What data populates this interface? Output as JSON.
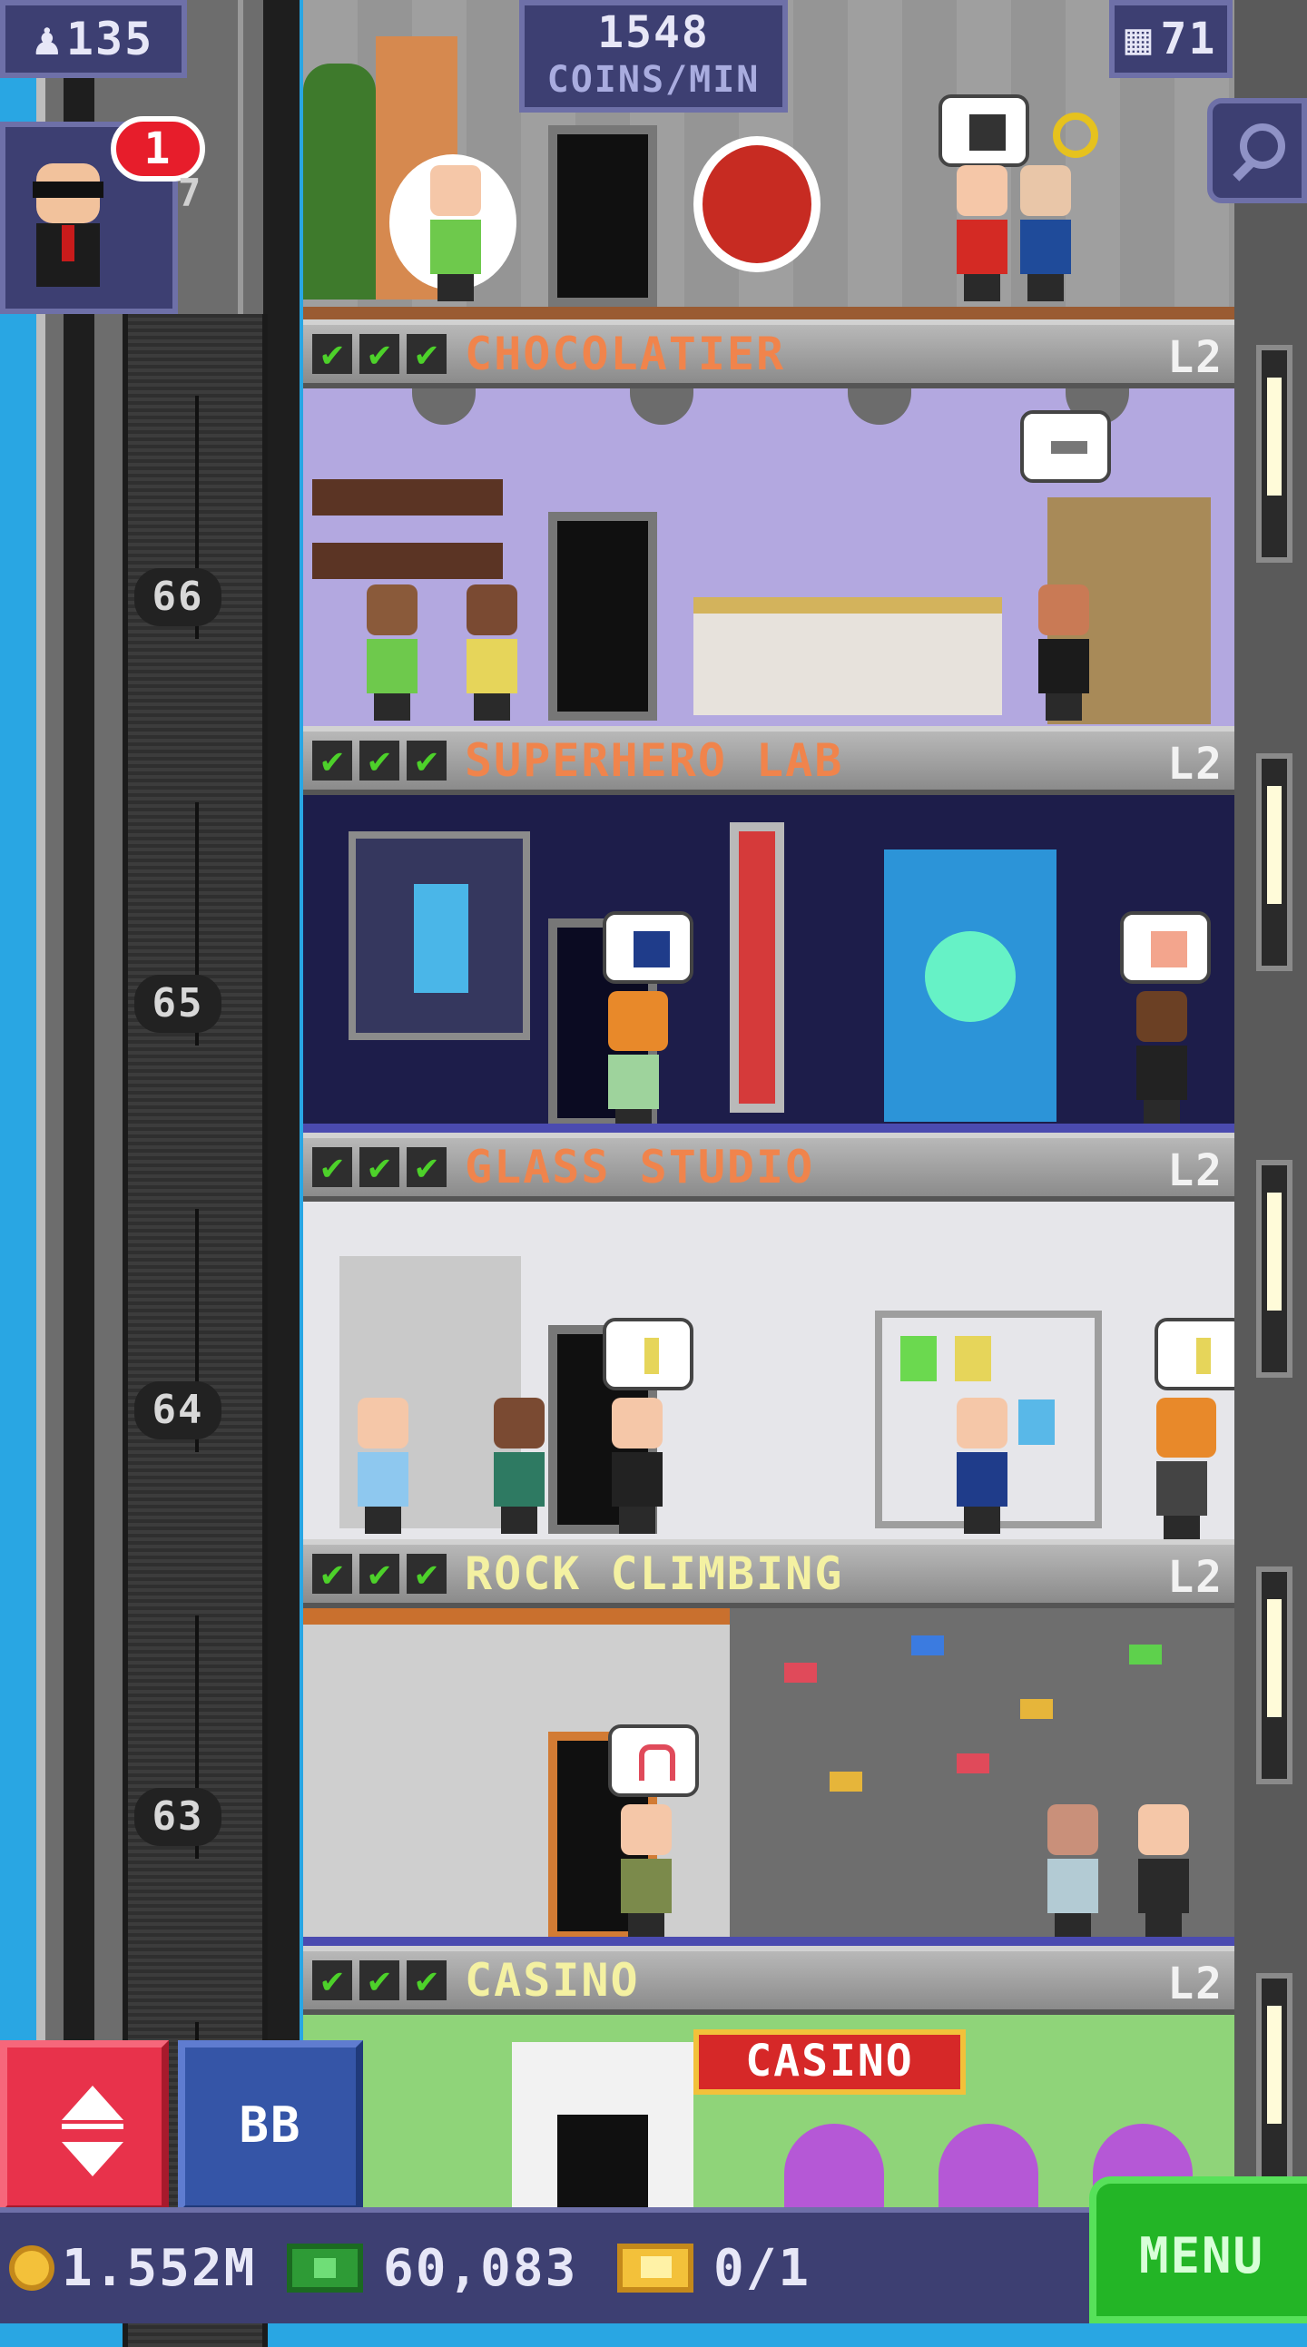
{
  "hud": {
    "population": "135",
    "coins_per_min_value": "1548",
    "coins_per_min_label": "COINS/MIN",
    "floor_count": "71"
  },
  "visitor": {
    "badge_count": "1",
    "target_floor": "7"
  },
  "shaft_floor_numbers": [
    "66",
    "65",
    "64",
    "63"
  ],
  "floors": [
    {
      "name": "CHOCOLATIER",
      "level": "L2",
      "checks": "✔",
      "name_color": "#f0844c"
    },
    {
      "name": "SUPERHERO LAB",
      "level": "L2",
      "checks": "✔",
      "name_color": "#f0844c"
    },
    {
      "name": "GLASS STUDIO",
      "level": "L2",
      "checks": "✔",
      "name_color": "#f0844c"
    },
    {
      "name": "ROCK CLIMBING",
      "level": "L2",
      "checks": "✔",
      "name_color": "#f4f1a2"
    },
    {
      "name": "CASINO",
      "level": "L2",
      "checks": "✔",
      "name_color": "#f4f1a2"
    }
  ],
  "casino_sign": "CASINO",
  "controls": {
    "bb_label": "BB",
    "menu_label": "MENU"
  },
  "currency": {
    "coins": "1.552M",
    "bux": "60,083",
    "tickets": "0/1"
  },
  "colors": {
    "sky": "#29a6e3",
    "hud_bg": "#3d3f72",
    "menu_green": "#23b526",
    "lift_red": "#e8324b",
    "bb_blue": "#3555a7"
  }
}
